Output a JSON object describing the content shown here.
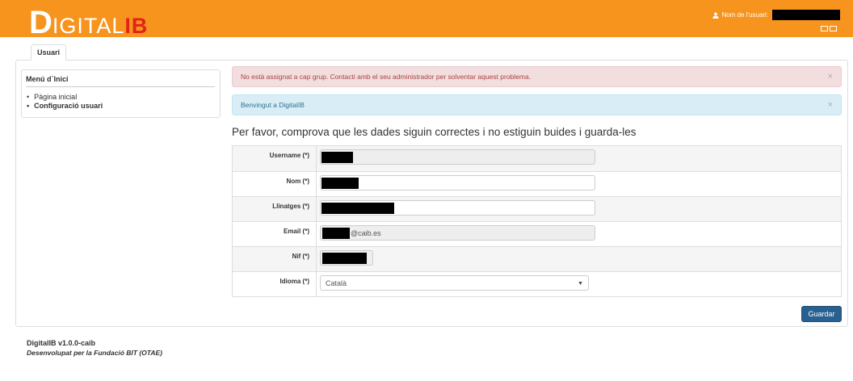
{
  "header": {
    "logo_first": "D",
    "logo_middle": "IGITAL",
    "logo_last": "IB",
    "user_label": "Nom de l'usuari:",
    "colors": {
      "bar": "#f7941e",
      "logo_accent": "#e2231a"
    }
  },
  "tabs": [
    {
      "label": "Usuari"
    }
  ],
  "sidebar": {
    "title": "Menú d´Inici",
    "items": [
      {
        "label": "Pàgina inicial"
      },
      {
        "label": "Configuració usuari"
      }
    ]
  },
  "alerts": {
    "danger": "No està assignat a cap grup. Contacti amb el seu administrador per solventar aquest problema.",
    "info": "Benvingut a DigitalIB",
    "close_glyph": "×"
  },
  "form": {
    "heading": "Per favor, comprova que les dades siguin correctes i no estiguin buides i guarda-les",
    "fields": [
      {
        "label": "Username  (*)"
      },
      {
        "label": "Nom  (*)"
      },
      {
        "label": "Llinatges  (*)"
      },
      {
        "label": "Email  (*)",
        "value_suffix": "@caib.es"
      },
      {
        "label": "Nif  (*)"
      },
      {
        "label": "Idioma  (*)",
        "value": "Català"
      }
    ],
    "save_label": "Guardar"
  },
  "footer": {
    "version": "DigitalIB v1.0.0-caib",
    "developer": "Desenvolupat per la Fundació BIT (OTAE)"
  }
}
